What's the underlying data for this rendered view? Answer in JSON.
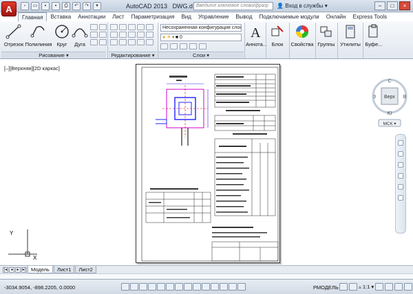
{
  "app": {
    "logo_letter": "A",
    "title": "AutoCAD 2013",
    "document": "DWG.d...",
    "search_placeholder": "Введите ключевое слово/фразу",
    "signin": "Вход в службы"
  },
  "ribbon_tabs": [
    "Главная",
    "Вставка",
    "Аннотации",
    "Лист",
    "Параметризация",
    "Вид",
    "Управление",
    "Вывод",
    "Подключаемые модули",
    "Онлайн",
    "Express Tools"
  ],
  "draw_group": {
    "tools": [
      "Отрезок",
      "Полилиния",
      "Круг",
      "Дуга"
    ],
    "label": "Рисование ▾"
  },
  "modify_group": {
    "label": "Редактирование ▾"
  },
  "layers_group": {
    "combo": "Несохраненная конфигурация слоя",
    "current_layer": "0",
    "label": "Слои ▾"
  },
  "right_tools": [
    "Аннота...",
    "Блок",
    "Свойства",
    "Группы",
    "Утилиты",
    "Буфе..."
  ],
  "viewport": {
    "label": "[–][Верхняя][2D каркас]",
    "viewcube_top": "Верх",
    "viewcube_north": "С",
    "viewcube_south": "Ю",
    "viewcube_east": "В",
    "viewcube_west": "З",
    "wcs_label": "МСК ▾",
    "ucs_x": "X",
    "ucs_y": "Y"
  },
  "layout_tabs": [
    "Модель",
    "Лист1",
    "Лист2"
  ],
  "status": {
    "coordinates": "-3034.9054, -898.2205, 0.0000",
    "model_label": "РМОДЕЛЬ",
    "scale": "1:1 ▾"
  }
}
